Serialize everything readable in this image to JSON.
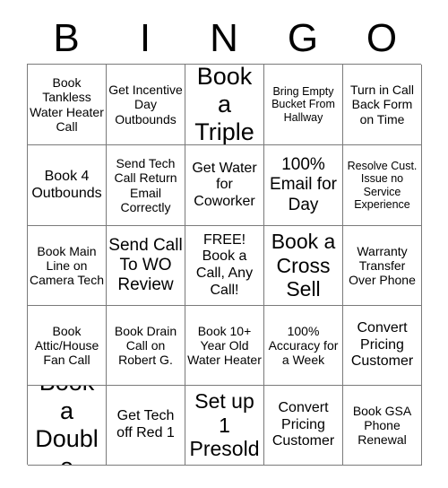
{
  "card": {
    "title": "BINGO Card",
    "header_letters": [
      "B",
      "I",
      "N",
      "G",
      "O"
    ],
    "columns": 5,
    "rows": 5,
    "colors": {
      "background": "#ffffff",
      "grid_line": "#7a7a7a",
      "text": "#000000"
    },
    "cells": [
      {
        "text": "Book Tankless Water Heater Call",
        "size": "s",
        "free": false
      },
      {
        "text": "Get Incentive Day Outbounds",
        "size": "s",
        "free": false
      },
      {
        "text": "Book a Triple",
        "size": "xxl",
        "free": false
      },
      {
        "text": "Bring Empty Bucket From Hallway",
        "size": "xs",
        "free": false
      },
      {
        "text": "Turn in Call Back Form on Time",
        "size": "s",
        "free": false
      },
      {
        "text": "Book 4 Outbounds",
        "size": "m",
        "free": false
      },
      {
        "text": "Send Tech Call Return Email Correctly",
        "size": "s",
        "free": false
      },
      {
        "text": "Get Water for Coworker",
        "size": "m",
        "free": false
      },
      {
        "text": "100% Email for Day",
        "size": "l",
        "free": false
      },
      {
        "text": "Resolve Cust. Issue no Service Experience",
        "size": "xs",
        "free": false
      },
      {
        "text": "Book Main Line on Camera Tech",
        "size": "s",
        "free": false
      },
      {
        "text": "Send Call To WO Review",
        "size": "l",
        "free": false
      },
      {
        "text": "FREE! Book a Call, Any Call!",
        "size": "m",
        "free": true
      },
      {
        "text": "Book a Cross Sell",
        "size": "xl",
        "free": false
      },
      {
        "text": "Warranty Transfer Over Phone",
        "size": "s",
        "free": false
      },
      {
        "text": "Book Attic/House Fan Call",
        "size": "s",
        "free": false
      },
      {
        "text": "Book Drain Call on Robert G.",
        "size": "s",
        "free": false
      },
      {
        "text": "Book 10+ Year Old Water Heater",
        "size": "s",
        "free": false
      },
      {
        "text": "100% Accuracy for a Week",
        "size": "s",
        "free": false
      },
      {
        "text": "Convert Pricing Customer",
        "size": "m",
        "free": false
      },
      {
        "text": "Book a Double",
        "size": "xxl",
        "free": false
      },
      {
        "text": "Get Tech off Red 1",
        "size": "m",
        "free": false
      },
      {
        "text": "Set up 1 Presold",
        "size": "xl",
        "free": false
      },
      {
        "text": "Convert Pricing Customer",
        "size": "m",
        "free": false
      },
      {
        "text": "Book GSA Phone Renewal",
        "size": "s",
        "free": false
      }
    ]
  }
}
